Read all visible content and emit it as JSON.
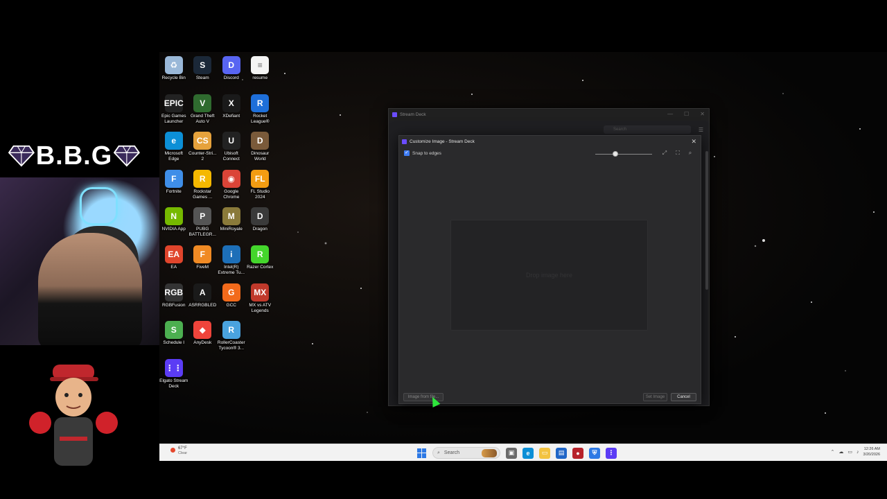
{
  "overlay": {
    "title": "B.B.G"
  },
  "desktop_icons": [
    {
      "label": "Recycle Bin",
      "glyph": "♻",
      "color": "#9ab8d8",
      "name": "recycle-bin-icon"
    },
    {
      "label": "Steam",
      "glyph": "S",
      "color": "#1b2838",
      "name": "steam-icon"
    },
    {
      "label": "Discord",
      "glyph": "D",
      "color": "#5865f2",
      "name": "discord-icon"
    },
    {
      "label": "resume",
      "glyph": "≡",
      "color": "#f4f4f4",
      "name": "document-icon"
    },
    {
      "label": "Epic Games Launcher",
      "glyph": "EPIC",
      "color": "#222222",
      "name": "epic-games-icon"
    },
    {
      "label": "Grand Theft Auto V",
      "glyph": "V",
      "color": "#2f6b2f",
      "name": "gta-v-icon"
    },
    {
      "label": "XDefiant",
      "glyph": "X",
      "color": "#1a1a1a",
      "name": "xdefiant-icon"
    },
    {
      "label": "Rocket League®",
      "glyph": "R",
      "color": "#1e6fd9",
      "name": "rocket-league-icon"
    },
    {
      "label": "Microsoft Edge",
      "glyph": "e",
      "color": "#0c8fd6",
      "name": "edge-icon"
    },
    {
      "label": "Counter-Stri... 2",
      "glyph": "CS",
      "color": "#e6a23c",
      "name": "counter-strike-icon"
    },
    {
      "label": "Ubisoft Connect",
      "glyph": "U",
      "color": "#222222",
      "name": "ubisoft-icon"
    },
    {
      "label": "Dinosaur World",
      "glyph": "D",
      "color": "#7a5a3a",
      "name": "dinosaur-world-icon"
    },
    {
      "label": "Fortnite",
      "glyph": "F",
      "color": "#3f8ee8",
      "name": "fortnite-icon"
    },
    {
      "label": "Rockstar Games ...",
      "glyph": "R",
      "color": "#f5b800",
      "name": "rockstar-icon"
    },
    {
      "label": "Google Chrome",
      "glyph": "◉",
      "color": "#db4437",
      "name": "chrome-icon"
    },
    {
      "label": "FL Studio 2024",
      "glyph": "FL",
      "color": "#f39c12",
      "name": "fl-studio-icon"
    },
    {
      "label": "NVIDIA App",
      "glyph": "N",
      "color": "#76b900",
      "name": "nvidia-icon"
    },
    {
      "label": "PUBG BATTLEGR...",
      "glyph": "P",
      "color": "#555555",
      "name": "pubg-icon"
    },
    {
      "label": "MiniRoyale",
      "glyph": "M",
      "color": "#8a7a3a",
      "name": "miniroyale-icon"
    },
    {
      "label": "Dragon",
      "glyph": "D",
      "color": "#3a3a3a",
      "name": "dragon-icon"
    },
    {
      "label": "EA",
      "glyph": "EA",
      "color": "#e0452c",
      "name": "ea-icon"
    },
    {
      "label": "FiveM",
      "glyph": "F",
      "color": "#f08a24",
      "name": "fivem-icon"
    },
    {
      "label": "Intel(R) Extreme Tu...",
      "glyph": "i",
      "color": "#1d6fb8",
      "name": "intel-xtu-icon"
    },
    {
      "label": "Razer Cortex",
      "glyph": "R",
      "color": "#44d62c",
      "name": "razer-cortex-icon"
    },
    {
      "label": "RGBFusion",
      "glyph": "RGB",
      "color": "#333333",
      "name": "rgbfusion-icon"
    },
    {
      "label": "ASRRGBLED",
      "glyph": "A",
      "color": "#1a1a1a",
      "name": "asrrgbled-icon"
    },
    {
      "label": "GCC",
      "glyph": "G",
      "color": "#f26a1b",
      "name": "gcc-icon"
    },
    {
      "label": "MX vs ATV Legends",
      "glyph": "MX",
      "color": "#c0392b",
      "name": "mx-vs-atv-icon"
    },
    {
      "label": "Schedule I",
      "glyph": "S",
      "color": "#4caf50",
      "name": "schedule-i-icon"
    },
    {
      "label": "AnyDesk",
      "glyph": "◆",
      "color": "#ef443b",
      "name": "anydesk-icon"
    },
    {
      "label": "RollerCoaster Tycoon® 3...",
      "glyph": "R",
      "color": "#4aa3df",
      "name": "rollercoaster-icon"
    },
    {
      "label": "",
      "glyph": "",
      "color": "transparent",
      "name": "empty-slot"
    },
    {
      "label": "Elgato Stream Deck",
      "glyph": "⋮⋮",
      "color": "#5b3cf5",
      "name": "stream-deck-icon"
    }
  ],
  "stream_deck": {
    "window_title": "Stream Deck",
    "search_placeholder": "Search"
  },
  "dialog": {
    "title": "Customize Image - Stream Deck",
    "snap_label": "Snap to edges",
    "drop_text": "Drop image here",
    "btn_file": "Image from file...",
    "btn_set": "Set Image",
    "btn_cancel": "Cancel",
    "zoom_level": 0.35
  },
  "taskbar": {
    "weather_temp": "67°F",
    "weather_cond": "Clear",
    "search_label": "Search",
    "time": "12:26 AM",
    "date": "3/20/2026"
  }
}
